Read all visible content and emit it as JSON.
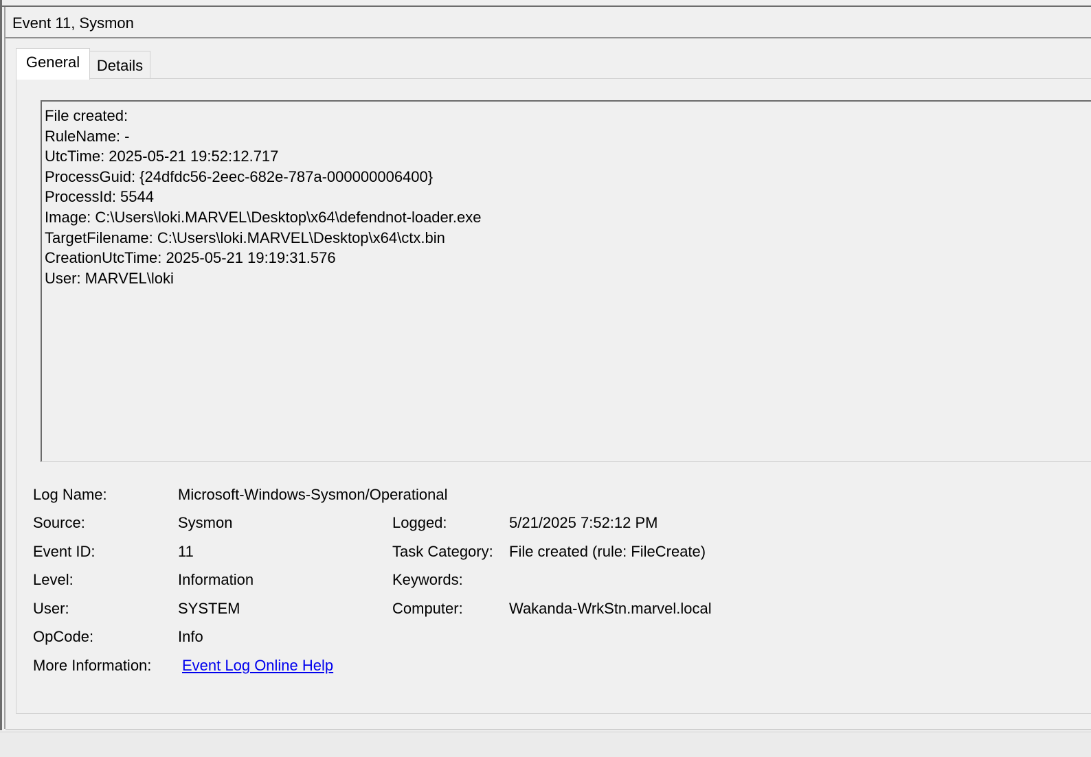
{
  "window": {
    "title": "Event 11, Sysmon"
  },
  "tabs": [
    {
      "label": "General",
      "selected": true
    },
    {
      "label": "Details",
      "selected": false
    }
  ],
  "description": {
    "lines": [
      "File created:",
      "RuleName: -",
      "UtcTime: 2025-05-21 19:52:12.717",
      "ProcessGuid: {24dfdc56-2eec-682e-787a-000000006400}",
      "ProcessId: 5544",
      "Image: C:\\Users\\loki.MARVEL\\Desktop\\x64\\defendnot-loader.exe",
      "TargetFilename: C:\\Users\\loki.MARVEL\\Desktop\\x64\\ctx.bin",
      "CreationUtcTime: 2025-05-21 19:19:31.576",
      "User: MARVEL\\loki"
    ]
  },
  "properties": {
    "log_name_label": "Log Name:",
    "log_name_value": "Microsoft-Windows-Sysmon/Operational",
    "source_label": "Source:",
    "source_value": "Sysmon",
    "logged_label": "Logged:",
    "logged_value": "5/21/2025 7:52:12 PM",
    "event_id_label": "Event ID:",
    "event_id_value": "11",
    "task_category_label": "Task Category:",
    "task_category_value": "File created (rule: FileCreate)",
    "level_label": "Level:",
    "level_value": "Information",
    "keywords_label": "Keywords:",
    "keywords_value": "",
    "user_label": "User:",
    "user_value": "SYSTEM",
    "computer_label": "Computer:",
    "computer_value": "Wakanda-WrkStn.marvel.local",
    "opcode_label": "OpCode:",
    "opcode_value": "Info",
    "more_info_label": "More Information:",
    "more_info_link": "Event Log Online Help"
  },
  "colors": {
    "background": "#f0f0f0",
    "link": "#0000ee",
    "tab_selected": "#ffffff"
  }
}
